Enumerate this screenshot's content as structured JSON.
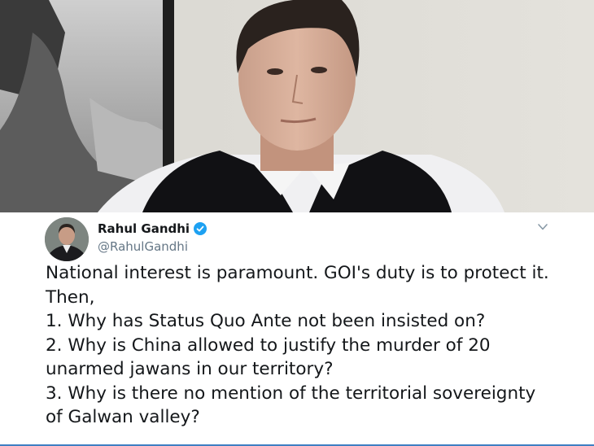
{
  "tweet": {
    "author_name": "Rahul Gandhi",
    "handle": "@RahulGandhi",
    "verified": true,
    "menu_icon": "chevron-down-icon",
    "lines": [
      "National interest is paramount. GOI's duty is to protect it.",
      "Then,",
      "1. Why has Status Quo Ante not been insisted on?",
      "2. Why is China allowed to justify the murder of 20",
      "unarmed jawans in our territory?",
      "3. Why is there no mention of the territorial sovereignty",
      "of Galwan valley?"
    ]
  },
  "colors": {
    "name_text": "#14171a",
    "handle_text": "#657786",
    "verified_badge": "#1da1f2",
    "accent_bar": "#3e7fc3"
  }
}
